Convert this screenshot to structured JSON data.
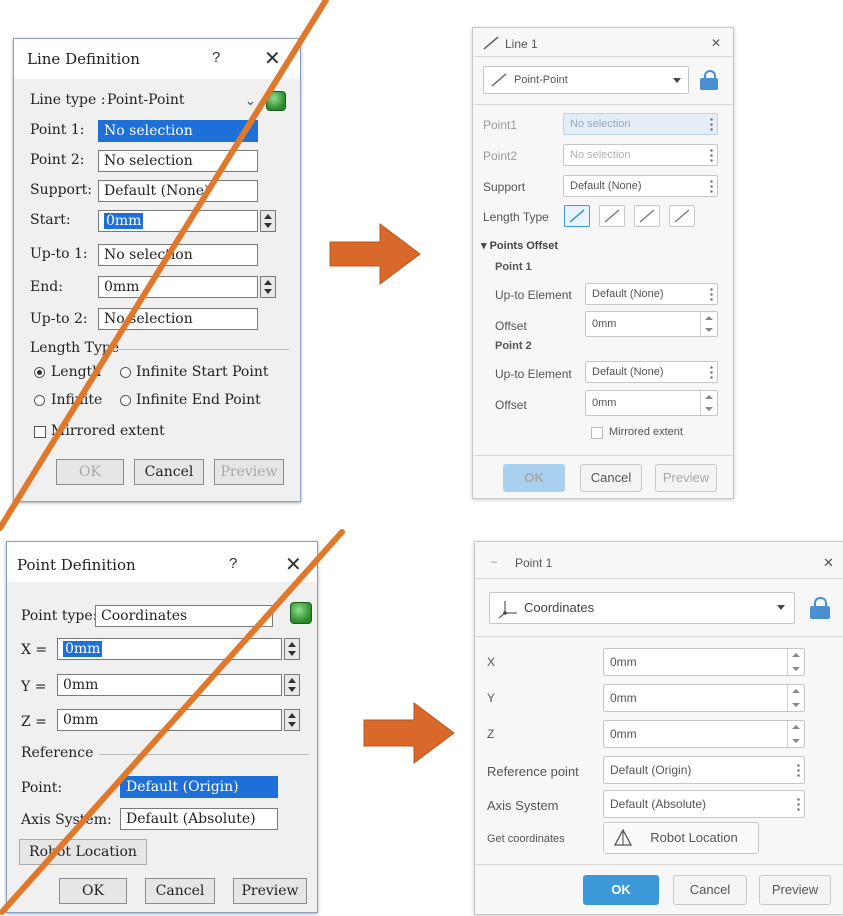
{
  "line_old": {
    "title": "Line Definition",
    "help": "?",
    "close": "✕",
    "line_type_label": "Line type :",
    "line_type_value": "Point-Point",
    "point1_label": "Point 1:",
    "point1_value": "No selection",
    "point2_label": "Point 2:",
    "point2_value": "No selection",
    "support_label": "Support:",
    "support_value": "Default (None)",
    "start_label": "Start:",
    "start_value": "0mm",
    "upto1_label": "Up-to 1:",
    "upto1_value": "No selection",
    "end_label": "End:",
    "end_value": "0mm",
    "upto2_label": "Up-to 2:",
    "upto2_value": "No selection",
    "length_type_label": "Length Type",
    "radio_length": "Length",
    "radio_infinite_start": "Infinite Start Point",
    "radio_infinite": "Infinite",
    "radio_infinite_end": "Infinite End Point",
    "mirrored": "Mirrored extent",
    "ok": "OK",
    "cancel": "Cancel",
    "preview": "Preview"
  },
  "line_new": {
    "title": "Line 1",
    "close": "✕",
    "type_value": "Point-Point",
    "point1_label": "Point1",
    "point1_value": "No selection",
    "point2_label": "Point2",
    "point2_value": "No selection",
    "support_label": "Support",
    "support_value": "Default (None)",
    "length_type_label": "Length Type",
    "points_offset": "▾ Points Offset",
    "point_1": "Point 1",
    "upto_element_1_label": "Up-to Element",
    "upto_element_1_value": "Default (None)",
    "offset_1_label": "Offset",
    "offset_1_value": "0mm",
    "point_2": "Point 2",
    "upto_element_2_label": "Up-to Element",
    "upto_element_2_value": "Default (None)",
    "offset_2_label": "Offset",
    "offset_2_value": "0mm",
    "mirrored": "Mirrored extent",
    "ok": "OK",
    "cancel": "Cancel",
    "preview": "Preview"
  },
  "point_old": {
    "title": "Point Definition",
    "help": "?",
    "close": "✕",
    "point_type_label": "Point type:",
    "point_type_value": "Coordinates",
    "x_label": "X =",
    "x_value": "0mm",
    "y_label": "Y =",
    "y_value": "0mm",
    "z_label": "Z =",
    "z_value": "0mm",
    "reference_label": "Reference",
    "point_label": "Point:",
    "point_value": "Default (Origin)",
    "axis_label": "Axis System:",
    "axis_value": "Default (Absolute)",
    "robot_location": "Robot Location",
    "ok": "OK",
    "cancel": "Cancel",
    "preview": "Preview"
  },
  "point_new": {
    "title": "Point 1",
    "close": "✕",
    "type_value": "Coordinates",
    "x_label": "X",
    "x_value": "0mm",
    "y_label": "Y",
    "y_value": "0mm",
    "z_label": "Z",
    "z_value": "0mm",
    "ref_point_label": "Reference point",
    "ref_point_value": "Default (Origin)",
    "axis_label": "Axis System",
    "axis_value": "Default (Absolute)",
    "get_coords_label": "Get coordinates",
    "robot_location": "Robot Location",
    "ok": "OK",
    "cancel": "Cancel",
    "preview": "Preview"
  },
  "colors": {
    "arrow": "#d9692a",
    "strike": "#e0782c",
    "accent_blue": "#3c98d8",
    "selection_blue": "#1e6fd8"
  },
  "icons": [
    "dropdown-chevron-icon",
    "green-cube-icon",
    "lock-icon",
    "line-icon",
    "coordinates-icon",
    "robot-location-icon",
    "arrow-right-icon"
  ]
}
